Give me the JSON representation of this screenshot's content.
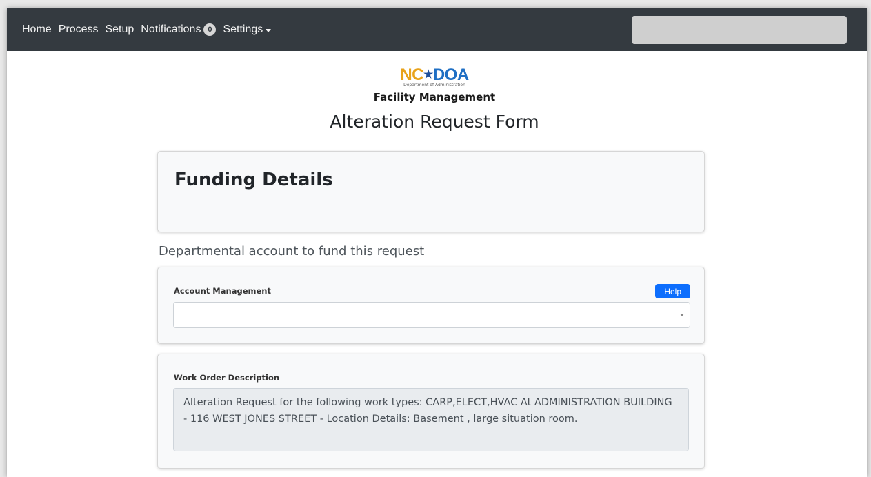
{
  "nav": {
    "items": [
      {
        "label": "Home"
      },
      {
        "label": "Process"
      },
      {
        "label": "Setup"
      },
      {
        "label": "Notifications",
        "badge": "0"
      },
      {
        "label": "Settings"
      }
    ],
    "search_value": ""
  },
  "logo": {
    "nc": "NC",
    "doa": "DOA",
    "subtitle": "Department of Administration",
    "division": "Facility Management"
  },
  "page": {
    "title": "Alteration Request Form"
  },
  "funding": {
    "heading": "Funding Details",
    "section_label": "Departmental account to fund this request"
  },
  "account": {
    "label": "Account Management",
    "help_label": "Help",
    "selected_value": ""
  },
  "work_order": {
    "label": "Work Order Description",
    "description": "Alteration Request for the following work types: CARP,ELECT,HVAC At ADMINISTRATION BUILDING - 116 WEST JONES STREET - Location Details: Basement , large situation room."
  },
  "colors": {
    "navbar": "#343a40",
    "accent": "#0d6efd",
    "logo_nc": "#e8a21a",
    "logo_doa": "#1f6fc4"
  }
}
